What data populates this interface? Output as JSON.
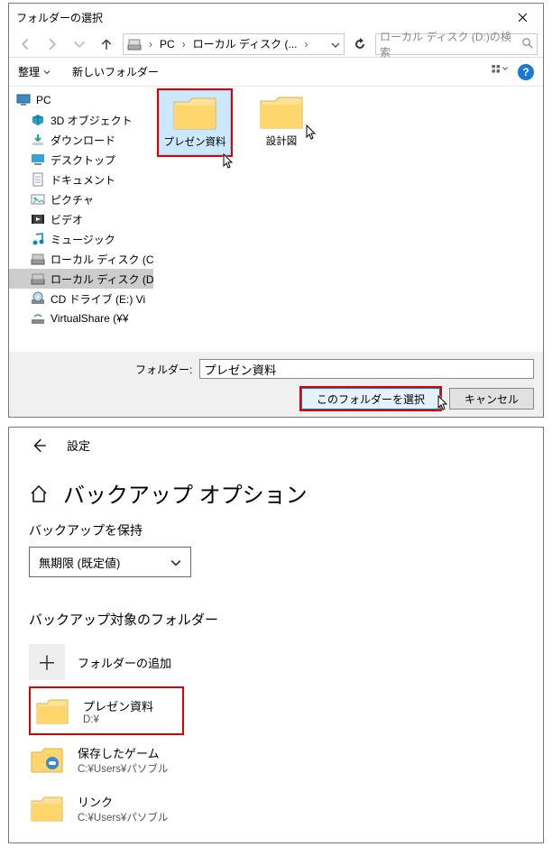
{
  "dialog": {
    "title": "フォルダーの選択",
    "nav": {
      "pc": "PC",
      "drive": "ローカル ディスク (...",
      "chev": "›",
      "path_sep": ">"
    },
    "search_placeholder": "ローカル ディスク (D:)の検索",
    "toolbar": {
      "organize": "整理",
      "newfolder": "新しいフォルダー"
    },
    "tree": [
      {
        "key": "pc",
        "icon": "pc",
        "label": "PC",
        "indent": 0
      },
      {
        "key": "3d",
        "icon": "3d",
        "label": "3D オブジェクト",
        "indent": 1
      },
      {
        "key": "dl",
        "icon": "dl",
        "label": "ダウンロード",
        "indent": 1
      },
      {
        "key": "dt",
        "icon": "dt",
        "label": "デスクトップ",
        "indent": 1
      },
      {
        "key": "doc",
        "icon": "doc",
        "label": "ドキュメント",
        "indent": 1
      },
      {
        "key": "pic",
        "icon": "pic",
        "label": "ピクチャ",
        "indent": 1
      },
      {
        "key": "vid",
        "icon": "vid",
        "label": "ビデオ",
        "indent": 1
      },
      {
        "key": "mus",
        "icon": "mus",
        "label": "ミュージック",
        "indent": 1
      },
      {
        "key": "dc",
        "icon": "hdd",
        "label": "ローカル ディスク (C",
        "indent": 1
      },
      {
        "key": "dd",
        "icon": "hdd",
        "label": "ローカル ディスク (D",
        "indent": 1,
        "selected": true
      },
      {
        "key": "cd",
        "icon": "cd",
        "label": "CD ドライブ (E:) Vi",
        "indent": 1
      },
      {
        "key": "vs",
        "icon": "net",
        "label": "VirtualShare (¥¥",
        "indent": 1
      }
    ],
    "contents": [
      {
        "label": "プレゼン資料",
        "selected": true,
        "redbox": true
      },
      {
        "label": "設計図"
      }
    ],
    "folder_label": "フォルダー:",
    "folder_value": "プレゼン資料",
    "btn_select": "このフォルダーを選択",
    "btn_cancel": "キャンセル"
  },
  "settings": {
    "top": "設定",
    "heading": "バックアップ オプション",
    "keep_label": "バックアップを保持",
    "keep_value": "無期限 (既定値)",
    "section2": "バックアップ対象のフォルダー",
    "add_label": "フォルダーの追加",
    "rows": [
      {
        "title": "プレゼン資料",
        "sub": "D:¥",
        "redbox": true,
        "ico": "plain"
      },
      {
        "title": "保存したゲーム",
        "sub": "C:¥Users¥パソブル",
        "ico": "game"
      },
      {
        "title": "リンク",
        "sub": "C:¥Users¥パソブル",
        "ico": "plain"
      }
    ]
  }
}
